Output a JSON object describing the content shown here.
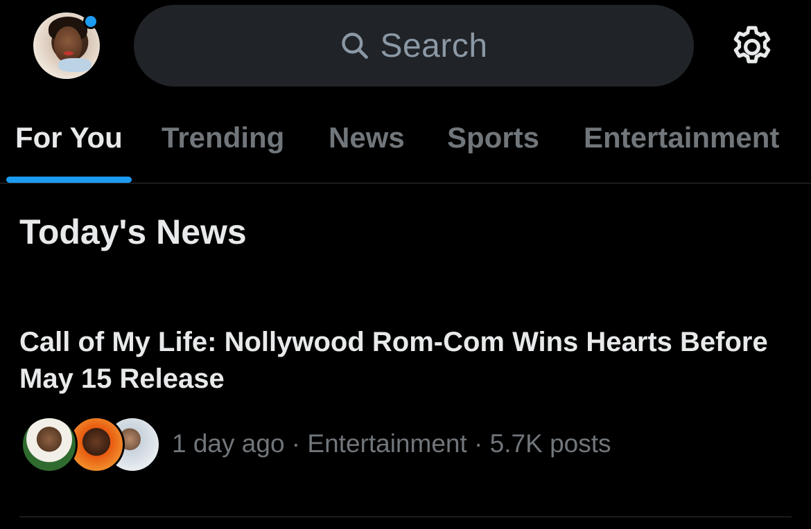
{
  "header": {
    "search_placeholder": "Search",
    "has_notification": true
  },
  "tabs": [
    {
      "label": "For You",
      "active": true
    },
    {
      "label": "Trending",
      "active": false
    },
    {
      "label": "News",
      "active": false
    },
    {
      "label": "Sports",
      "active": false
    },
    {
      "label": "Entertainment",
      "active": false
    }
  ],
  "section": {
    "title": "Today's News"
  },
  "story": {
    "headline": "Call of My Life: Nollywood Rom-Com Wins Hearts Before May 15 Release",
    "time": "1 day ago",
    "category": "Entertainment",
    "posts": "5.7K posts",
    "separator": " · "
  },
  "icons": {
    "search": "search-icon",
    "settings": "gear-icon"
  },
  "colors": {
    "accent": "#1d9bf0",
    "background": "#000000",
    "text_primary": "#e7e9ea",
    "text_secondary": "#71767b",
    "search_bg": "#202327"
  }
}
